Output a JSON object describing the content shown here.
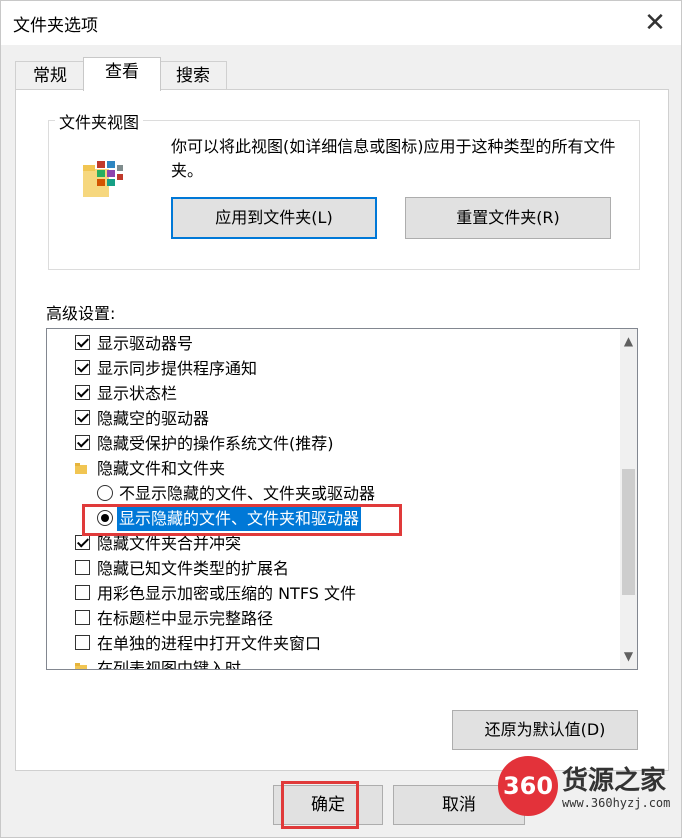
{
  "window": {
    "title": "文件夹选项"
  },
  "tabs": [
    {
      "label": "常规"
    },
    {
      "label": "查看"
    },
    {
      "label": "搜索"
    }
  ],
  "folder_views": {
    "title": "文件夹视图",
    "description": "你可以将此视图(如详细信息或图标)应用于这种类型的所有文件夹。",
    "apply_button": "应用到文件夹(L)",
    "reset_button": "重置文件夹(R)"
  },
  "advanced": {
    "label": "高级设置:",
    "items": [
      {
        "type": "checkbox",
        "checked": true,
        "label": "显示驱动器号"
      },
      {
        "type": "checkbox",
        "checked": true,
        "label": "显示同步提供程序通知"
      },
      {
        "type": "checkbox",
        "checked": true,
        "label": "显示状态栏"
      },
      {
        "type": "checkbox",
        "checked": true,
        "label": "隐藏空的驱动器"
      },
      {
        "type": "checkbox",
        "checked": true,
        "label": "隐藏受保护的操作系统文件(推荐)"
      },
      {
        "type": "folder",
        "label": "隐藏文件和文件夹"
      },
      {
        "type": "radio",
        "checked": false,
        "label": "不显示隐藏的文件、文件夹或驱动器"
      },
      {
        "type": "radio",
        "checked": true,
        "label": "显示隐藏的文件、文件夹和驱动器"
      },
      {
        "type": "checkbox",
        "checked": true,
        "label": "隐藏文件夹合并冲突"
      },
      {
        "type": "checkbox",
        "checked": false,
        "label": "隐藏已知文件类型的扩展名"
      },
      {
        "type": "checkbox",
        "checked": false,
        "label": "用彩色显示加密或压缩的 NTFS 文件"
      },
      {
        "type": "checkbox",
        "checked": false,
        "label": "在标题栏中显示完整路径"
      },
      {
        "type": "checkbox",
        "checked": false,
        "label": "在单独的进程中打开文件夹窗口"
      },
      {
        "type": "folder",
        "label": "在列表视图中键入时"
      }
    ],
    "restore_button": "还原为默认值(D)"
  },
  "footer": {
    "ok": "确定",
    "cancel": "取消"
  },
  "watermark": {
    "logo": "360",
    "name": "货源之家",
    "url": "www.360hyzj.com"
  }
}
